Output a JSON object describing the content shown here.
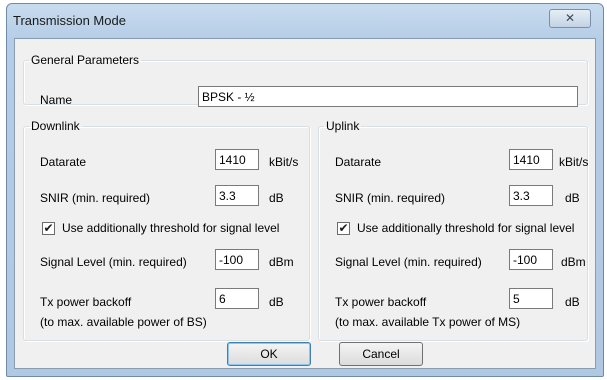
{
  "window": {
    "title": "Transmission Mode",
    "close_glyph": "✕"
  },
  "general": {
    "legend": "General Parameters",
    "name_label": "Name",
    "name_value": "BPSK - ½"
  },
  "downlink": {
    "legend": "Downlink",
    "datarate_label": "Datarate",
    "datarate_value": "1410",
    "datarate_unit": "kBit/s",
    "snir_label": "SNIR (min. required)",
    "snir_value": "3.3",
    "snir_unit": "dB",
    "threshold_checked": true,
    "threshold_label": "Use additionally threshold for signal level",
    "signal_label": "Signal Level (min. required)",
    "signal_value": "-100",
    "signal_unit": "dBm",
    "backoff_label": "Tx power backoff",
    "backoff_value": "6",
    "backoff_unit": "dB",
    "backoff_note": "(to max. available power of BS)"
  },
  "uplink": {
    "legend": "Uplink",
    "datarate_label": "Datarate",
    "datarate_value": "1410",
    "datarate_unit": "kBit/s",
    "snir_label": "SNIR (min. required)",
    "snir_value": "3.3",
    "snir_unit": "dB",
    "threshold_checked": true,
    "threshold_label": "Use additionally threshold for signal level",
    "signal_label": "Signal Level (min. required)",
    "signal_value": "-100",
    "signal_unit": "dBm",
    "backoff_label": "Tx power backoff",
    "backoff_value": "5",
    "backoff_unit": "dB",
    "backoff_note": "(to max. available Tx power of MS)"
  },
  "buttons": {
    "ok": "OK",
    "cancel": "Cancel"
  },
  "icons": {
    "checkmark": "✔"
  }
}
